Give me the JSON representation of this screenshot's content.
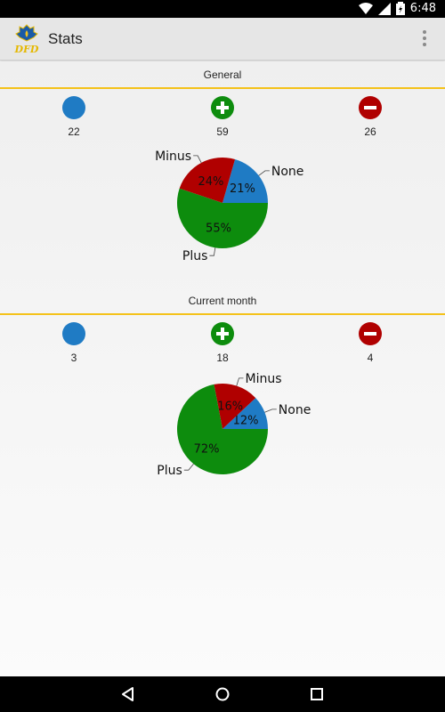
{
  "status_bar": {
    "time": "6:48"
  },
  "app_bar": {
    "title": "Stats",
    "logo_text": "DFD"
  },
  "sections": [
    {
      "header": "General",
      "counts": {
        "none": "22",
        "plus": "59",
        "minus": "26"
      }
    },
    {
      "header": "Current month",
      "counts": {
        "none": "3",
        "plus": "18",
        "minus": "4"
      }
    }
  ],
  "chart_data": [
    {
      "type": "pie",
      "title": "",
      "categories": [
        "None",
        "Minus",
        "Plus"
      ],
      "values": [
        22,
        26,
        59
      ],
      "percent_labels": [
        "21%",
        "24%",
        "55%"
      ],
      "colors": [
        "#1f7bc4",
        "#b00000",
        "#0d8c0d"
      ]
    },
    {
      "type": "pie",
      "title": "",
      "categories": [
        "None",
        "Minus",
        "Plus"
      ],
      "values": [
        3,
        4,
        18
      ],
      "percent_labels": [
        "12%",
        "16%",
        "72%"
      ],
      "colors": [
        "#1f7bc4",
        "#b00000",
        "#0d8c0d"
      ]
    }
  ],
  "icons": {
    "none": "filled-circle-icon",
    "plus": "plus-circle-icon",
    "minus": "minus-circle-icon",
    "menu": "overflow-menu-icon",
    "back": "back-triangle-icon",
    "home": "home-circle-icon",
    "recents": "recents-square-icon"
  }
}
